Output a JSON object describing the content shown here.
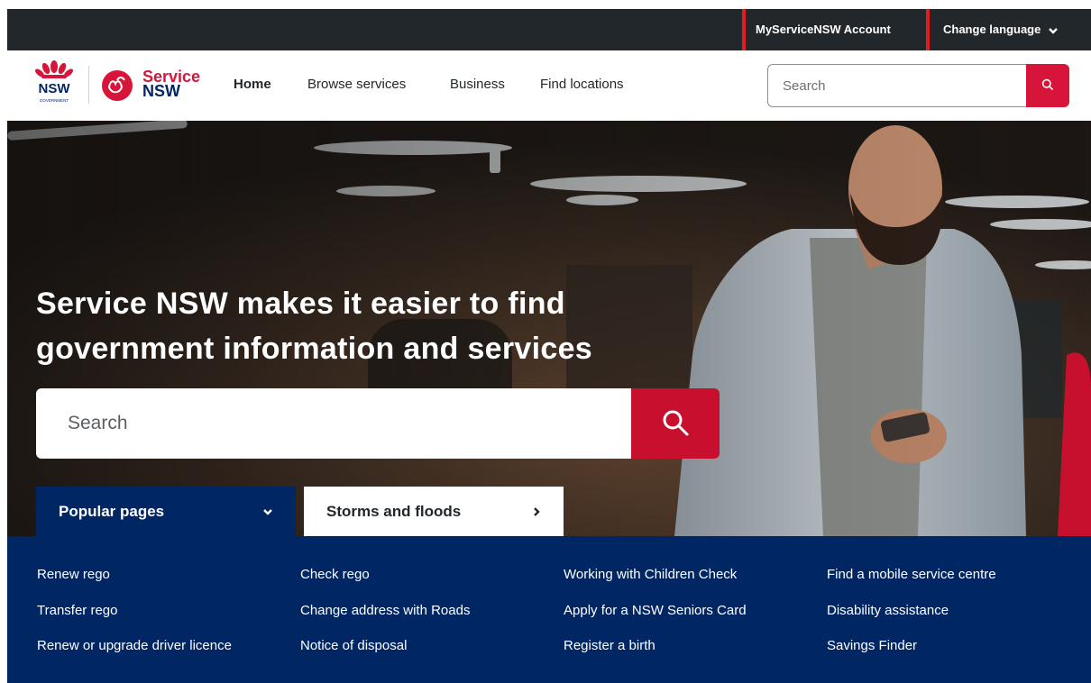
{
  "utility_bar": {
    "account_label": "MyServiceNSW Account",
    "language_label": "Change language"
  },
  "header": {
    "logo_nsw_text": "NSW",
    "logo_gov_text": "GOVERNMENT",
    "logo_service_line1": "Service",
    "logo_service_line2": "NSW",
    "nav": {
      "home": "Home",
      "browse": "Browse services",
      "business": "Business",
      "locations": "Find locations"
    },
    "search_placeholder": "Search"
  },
  "hero": {
    "headline": "Service NSW makes it easier to find government information and services",
    "search_placeholder": "Search"
  },
  "tabs": {
    "popular": "Popular pages",
    "storms": "Storms and floods"
  },
  "popular_links": {
    "col1": [
      "Renew rego",
      "Transfer rego",
      "Renew or upgrade driver licence"
    ],
    "col2": [
      "Check rego",
      "Change address with Roads",
      "Notice of disposal"
    ],
    "col3": [
      "Working with Children Check",
      "Apply for a NSW Seniors Card",
      "Register a birth"
    ],
    "col4": [
      "Find a mobile service centre",
      "Disability assistance",
      "Savings Finder"
    ]
  },
  "colors": {
    "brand_red": "#d7153a",
    "brand_navy": "#002664",
    "utility_bg": "#22272b",
    "highlight_box": "#e21d1d"
  }
}
